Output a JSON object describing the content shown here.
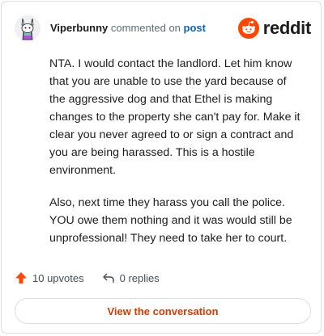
{
  "header": {
    "username": "Viperbunny",
    "commented_on_text": "commented on",
    "post_link_text": "post",
    "brand": "reddit"
  },
  "comment": {
    "paragraphs": [
      "NTA. I would contact the landlord. Let him know that you are unable to use the yard because of the aggressive dog and that Ethel is making changes to the property she can't pay for. Make it clear you never agreed to or sign a contract and you are being harassed. This is a hostile environment.",
      "Also, next time they harass you call the police. YOU owe them nothing and it was would still be unprofessional! They need to take her to court."
    ]
  },
  "actions": {
    "upvotes_label": "10 upvotes",
    "replies_label": "0 replies"
  },
  "cta": {
    "label": "View the conversation"
  },
  "colors": {
    "brand_orange": "#ff4500",
    "upvote_orange": "#ff4500",
    "cta_text": "#d93a00",
    "post_link": "#0e63cf",
    "meta_gray": "#576f76"
  },
  "icons": {
    "avatar": "snoo-avatar",
    "logo": "reddit-logo-icon",
    "upvote": "upvote-arrow-icon",
    "reply": "reply-arrow-icon"
  }
}
